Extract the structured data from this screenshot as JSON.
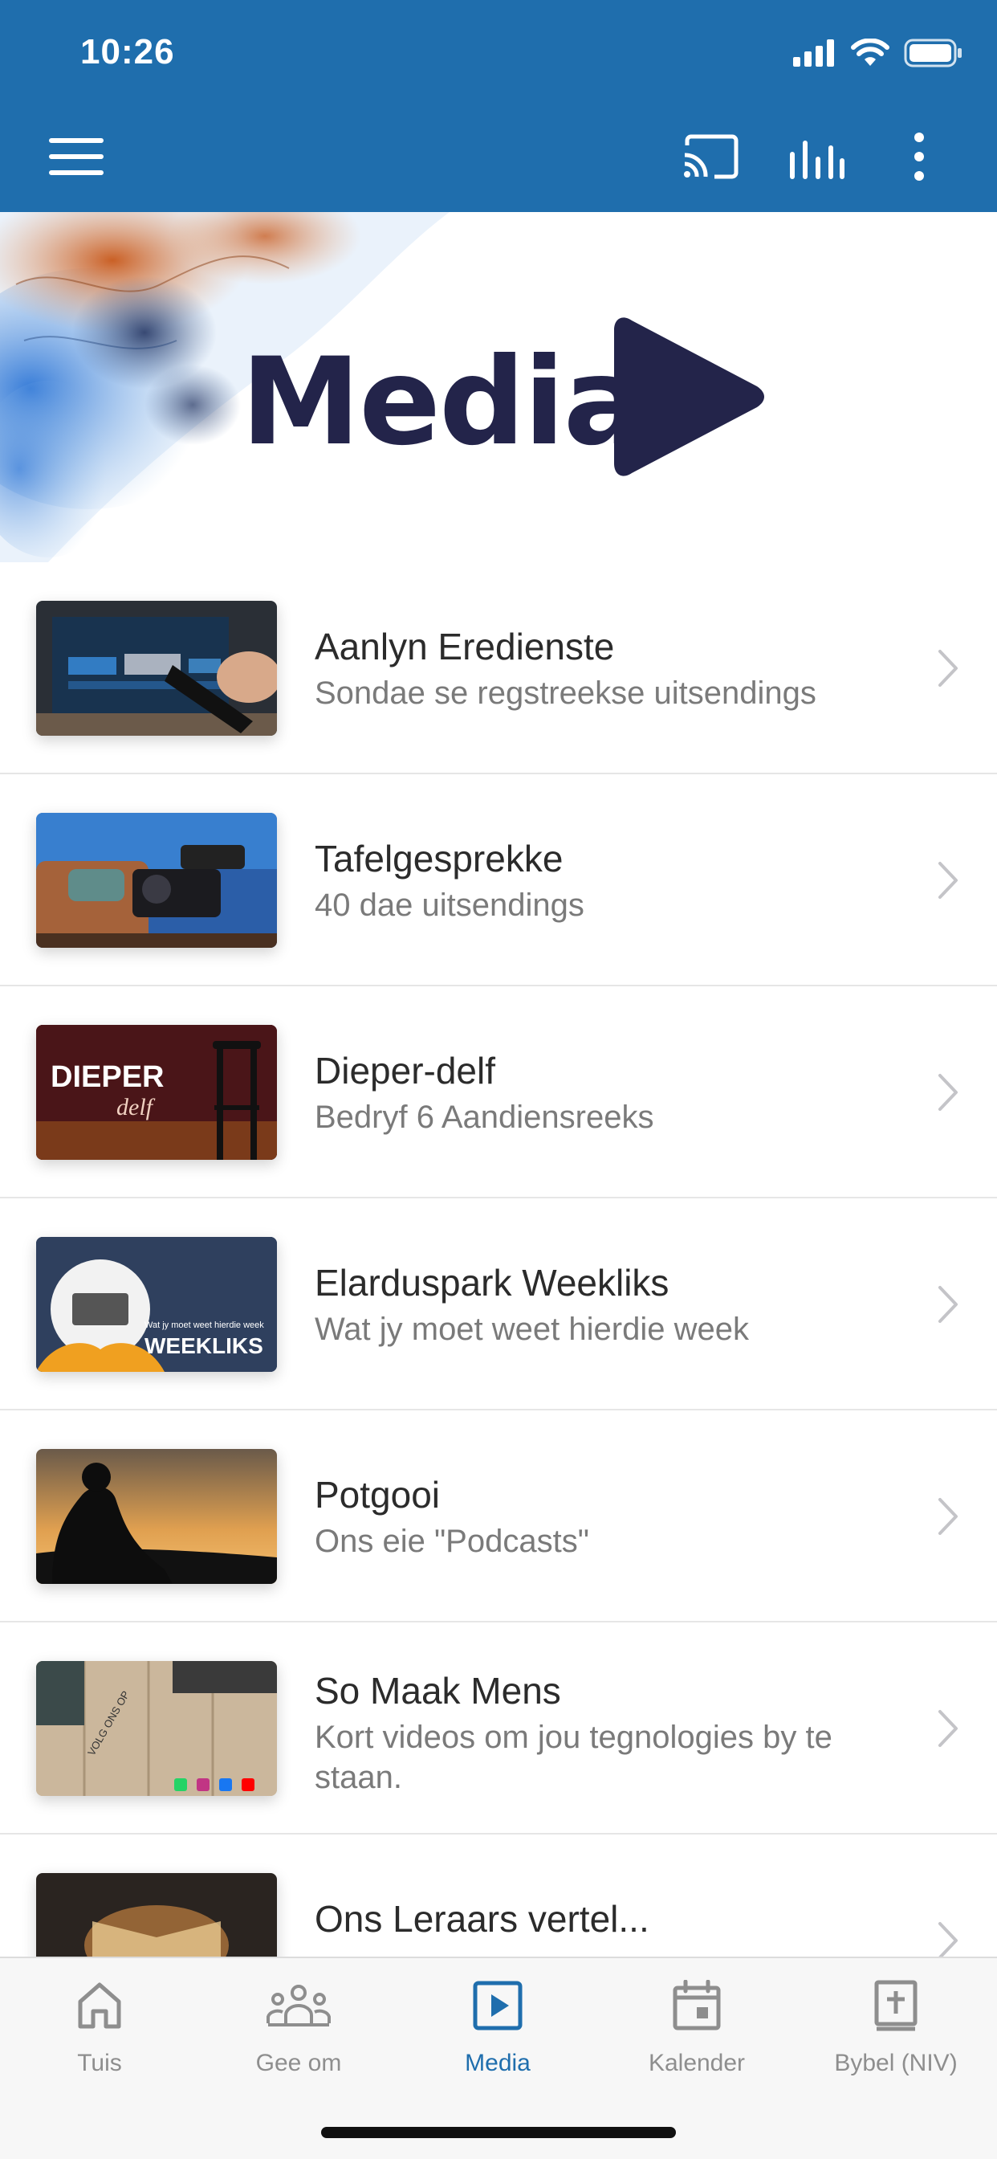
{
  "status_bar": {
    "time": "10:26"
  },
  "toolbar": {
    "menu_icon": "hamburger-menu-icon",
    "cast_icon": "cast-icon",
    "chart_icon": "bar-chart-icon",
    "more_icon": "more-vertical-icon"
  },
  "hero": {
    "title": "Media"
  },
  "list": [
    {
      "title": "Aanlyn Eredienste",
      "subtitle": "Sondae se regstreekse uitsendings"
    },
    {
      "title": "Tafelgesprekke",
      "subtitle": "40 dae uitsendings"
    },
    {
      "title": "Dieper-delf",
      "subtitle": "Bedryf 6 Aandiensreeks",
      "thumb_text": "DIEPER",
      "thumb_script": "delf"
    },
    {
      "title": "Elarduspark Weekliks",
      "subtitle": "Wat jy moet weet hierdie week",
      "thumb_text": "WEEKLIKS",
      "thumb_caption": "Wat jy moet weet hierdie week"
    },
    {
      "title": "Potgooi",
      "subtitle": "Ons eie \"Podcasts\""
    },
    {
      "title": "So Maak Mens",
      "subtitle": "Kort videos om jou tegnologies by te staan.",
      "thumb_text": "VOLG ONS OP"
    },
    {
      "title": "Ons Leraars vertel...",
      "subtitle": ""
    }
  ],
  "tabs": [
    {
      "label": "Tuis",
      "icon": "home-icon",
      "active": false
    },
    {
      "label": "Gee om",
      "icon": "group-icon",
      "active": false
    },
    {
      "label": "Media",
      "icon": "play-square-icon",
      "active": true
    },
    {
      "label": "Kalender",
      "icon": "calendar-icon",
      "active": false
    },
    {
      "label": "Bybel (NIV)",
      "icon": "bible-icon",
      "active": false
    }
  ],
  "colors": {
    "primary": "#1f6ead",
    "hero_text": "#23244a",
    "inactive": "#8e8e8e"
  }
}
